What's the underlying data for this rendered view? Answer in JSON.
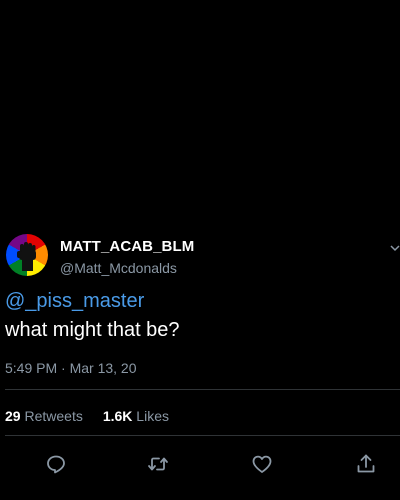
{
  "tweet": {
    "display_name": "MATT_ACAB_BLM",
    "handle": "@Matt_Mcdonalds",
    "mention": "@_piss_master",
    "text": "what might that be?",
    "timestamp": "5:49 PM · Mar 13, 20",
    "stats": {
      "retweets_count": "29",
      "retweets_label": "Retweets",
      "likes_count": "1.6K",
      "likes_label": "Likes"
    }
  },
  "icons": {
    "avatar": "raised-fist-on-rainbow",
    "caret": "chevron-down-icon",
    "actions": [
      "reply-icon",
      "retweet-icon",
      "like-icon",
      "share-icon"
    ]
  },
  "colors": {
    "background": "#000000",
    "text_primary": "#ffffff",
    "text_secondary": "#8b98a5",
    "mention": "#4a9be8",
    "divider": "#2f3336"
  }
}
